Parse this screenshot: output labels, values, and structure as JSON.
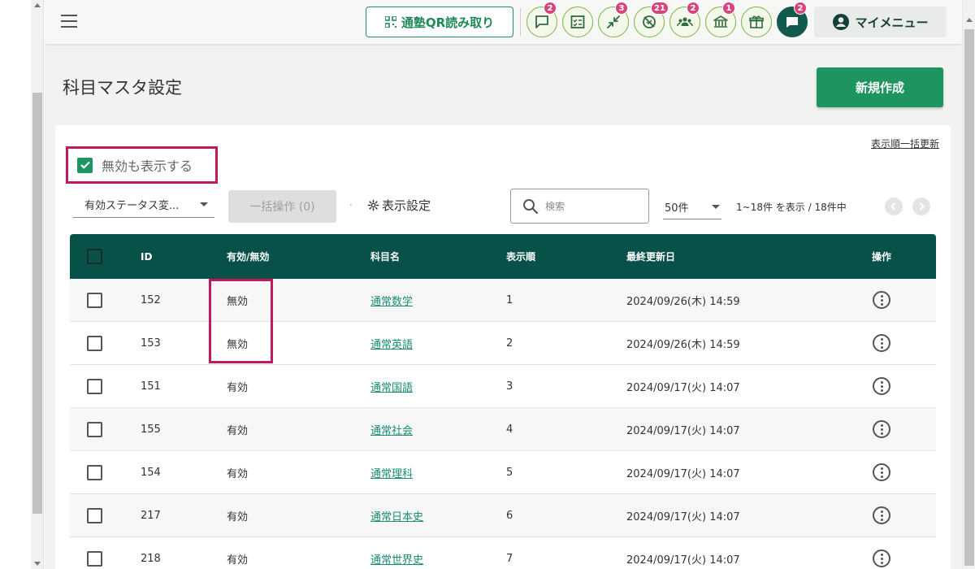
{
  "header": {
    "qr_button_label": "通塾QR読み取り",
    "icons": [
      {
        "name": "chat-icon",
        "badge": "2"
      },
      {
        "name": "checklist-icon",
        "badge": ""
      },
      {
        "name": "arrows-inward-icon",
        "badge": "3"
      },
      {
        "name": "no-sign-icon",
        "badge": "21"
      },
      {
        "name": "group-icon",
        "badge": "2"
      },
      {
        "name": "school-icon",
        "badge": "1"
      },
      {
        "name": "gift-icon",
        "badge": ""
      },
      {
        "name": "message-icon",
        "badge": "2"
      }
    ],
    "my_menu_label": "マイメニュー"
  },
  "page": {
    "title": "科目マスタ設定",
    "create_button": "新規作成"
  },
  "toolbar": {
    "reorder_link": "表示順一括更新",
    "show_inactive_label": "無効も表示する",
    "show_inactive_checked": true,
    "status_select": "有効ステータス変...",
    "bulk_action": "一括操作 (0)",
    "separator": "·",
    "display_settings": "表示設定",
    "search_placeholder": "検索",
    "per_page": "50件",
    "range_info": "1~18件 を表示 / 18件中"
  },
  "table": {
    "headers": {
      "id": "ID",
      "status": "有効/無効",
      "name": "科目名",
      "order": "表示順",
      "updated": "最終更新日",
      "actions": "操作"
    },
    "rows": [
      {
        "id": "152",
        "status": "無効",
        "name": "通常数学",
        "order": "1",
        "updated": "2024/09/26(木) 14:59"
      },
      {
        "id": "153",
        "status": "無効",
        "name": "通常英語",
        "order": "2",
        "updated": "2024/09/26(木) 14:59"
      },
      {
        "id": "151",
        "status": "有効",
        "name": "通常国語",
        "order": "3",
        "updated": "2024/09/17(火) 14:07"
      },
      {
        "id": "155",
        "status": "有効",
        "name": "通常社会",
        "order": "4",
        "updated": "2024/09/17(火) 14:07"
      },
      {
        "id": "154",
        "status": "有効",
        "name": "通常理科",
        "order": "5",
        "updated": "2024/09/17(火) 14:07"
      },
      {
        "id": "217",
        "status": "有効",
        "name": "通常日本史",
        "order": "6",
        "updated": "2024/09/17(火) 14:07"
      },
      {
        "id": "218",
        "status": "有効",
        "name": "通常世界史",
        "order": "7",
        "updated": "2024/09/17(火) 14:07"
      }
    ]
  },
  "colors": {
    "primary_green": "#1e9460",
    "header_teal": "#075149",
    "highlight": "#c1195e",
    "badge": "#d6457b"
  }
}
